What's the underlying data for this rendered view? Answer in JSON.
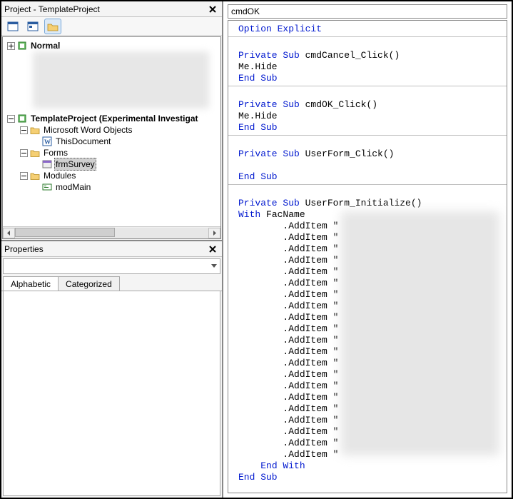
{
  "project_panel": {
    "title": "Project - TemplateProject",
    "toolbar_modes": [
      "view-code",
      "view-object",
      "view-folder"
    ],
    "root_normal": "Normal",
    "root_template": "TemplateProject (Experimental Investigat",
    "folder_word": "Microsoft Word Objects",
    "item_thisdoc": "ThisDocument",
    "folder_forms": "Forms",
    "item_frm": "frmSurvey",
    "folder_modules": "Modules",
    "item_mod": "modMain"
  },
  "properties_panel": {
    "title": "Properties",
    "tab_alpha": "Alphabetic",
    "tab_cat": "Categorized"
  },
  "right": {
    "object_dd": "cmdOK",
    "code": {
      "l0": "Option Explicit",
      "l1a": "Private Sub",
      "l1b": " cmdCancel_Click()",
      "l2": "Me.Hide",
      "l3": "End Sub",
      "l4a": "Private Sub",
      "l4b": " cmdOK_Click()",
      "l5": "Me.Hide",
      "l6": "End Sub",
      "l7a": "Private Sub",
      "l7b": " UserForm_Click()",
      "l8": "End Sub",
      "l9a": "Private Sub",
      "l9b": " UserForm_Initialize()",
      "l10a": "With",
      "l10b": " FacName",
      "additem": ".AddItem \"",
      "l11": "End With",
      "l12": "End Sub"
    }
  }
}
